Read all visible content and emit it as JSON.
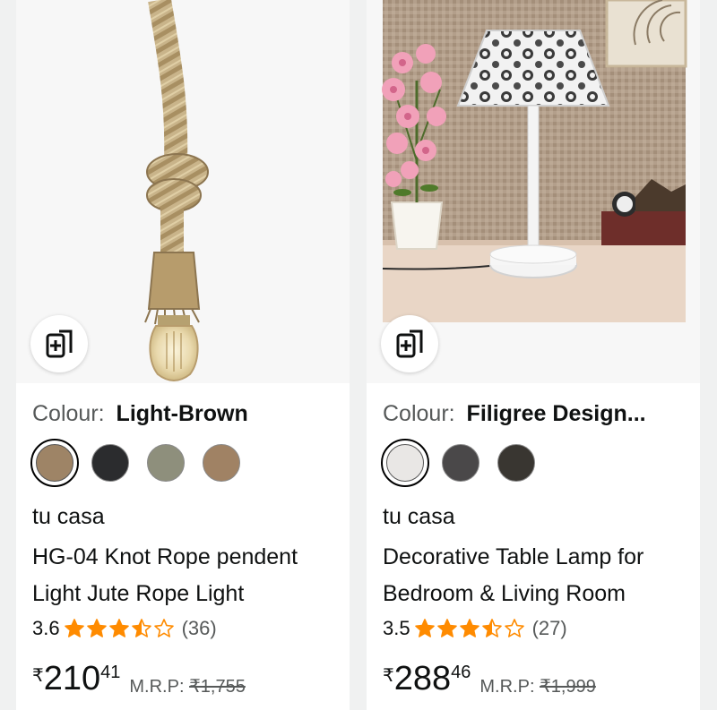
{
  "products": [
    {
      "image_alt": "Jute rope pendant light with knot and Edison bulb",
      "colour_label": "Colour:",
      "colour_value": "Light-Brown",
      "swatches": [
        "#9e8466",
        "#2b2c2e",
        "#8e8f7c",
        "#a08264"
      ],
      "selected_swatch": 0,
      "brand": "tu casa",
      "title": "HG-04 Knot Rope pendent Light Jute Rope Light",
      "rating": "3.6",
      "stars": 3.5,
      "review_count": "(36)",
      "currency": "₹",
      "price_whole": "210",
      "price_fraction": "41",
      "mrp_label": "M.R.P:",
      "mrp_value": "₹1,755"
    },
    {
      "image_alt": "Decorative table lamp with filigree design shade",
      "colour_label": "Colour:",
      "colour_value": "Filigree Design...",
      "swatches": [
        "#e9e7e5",
        "#4a4849",
        "#393631"
      ],
      "selected_swatch": 0,
      "brand": "tu casa",
      "title": "Decorative Table Lamp for Bedroom & Living Room",
      "rating": "3.5",
      "stars": 3.5,
      "review_count": "(27)",
      "currency": "₹",
      "price_whole": "288",
      "price_fraction": "46",
      "mrp_label": "M.R.P:",
      "mrp_value": "₹1,999"
    }
  ],
  "icons": {
    "compare": "compare-add-icon",
    "star_full": "star-full-icon",
    "star_half": "star-half-icon",
    "star_empty": "star-empty-icon"
  },
  "colors": {
    "star": "#ff8b00",
    "text": "#0f1111",
    "muted": "#565959"
  }
}
